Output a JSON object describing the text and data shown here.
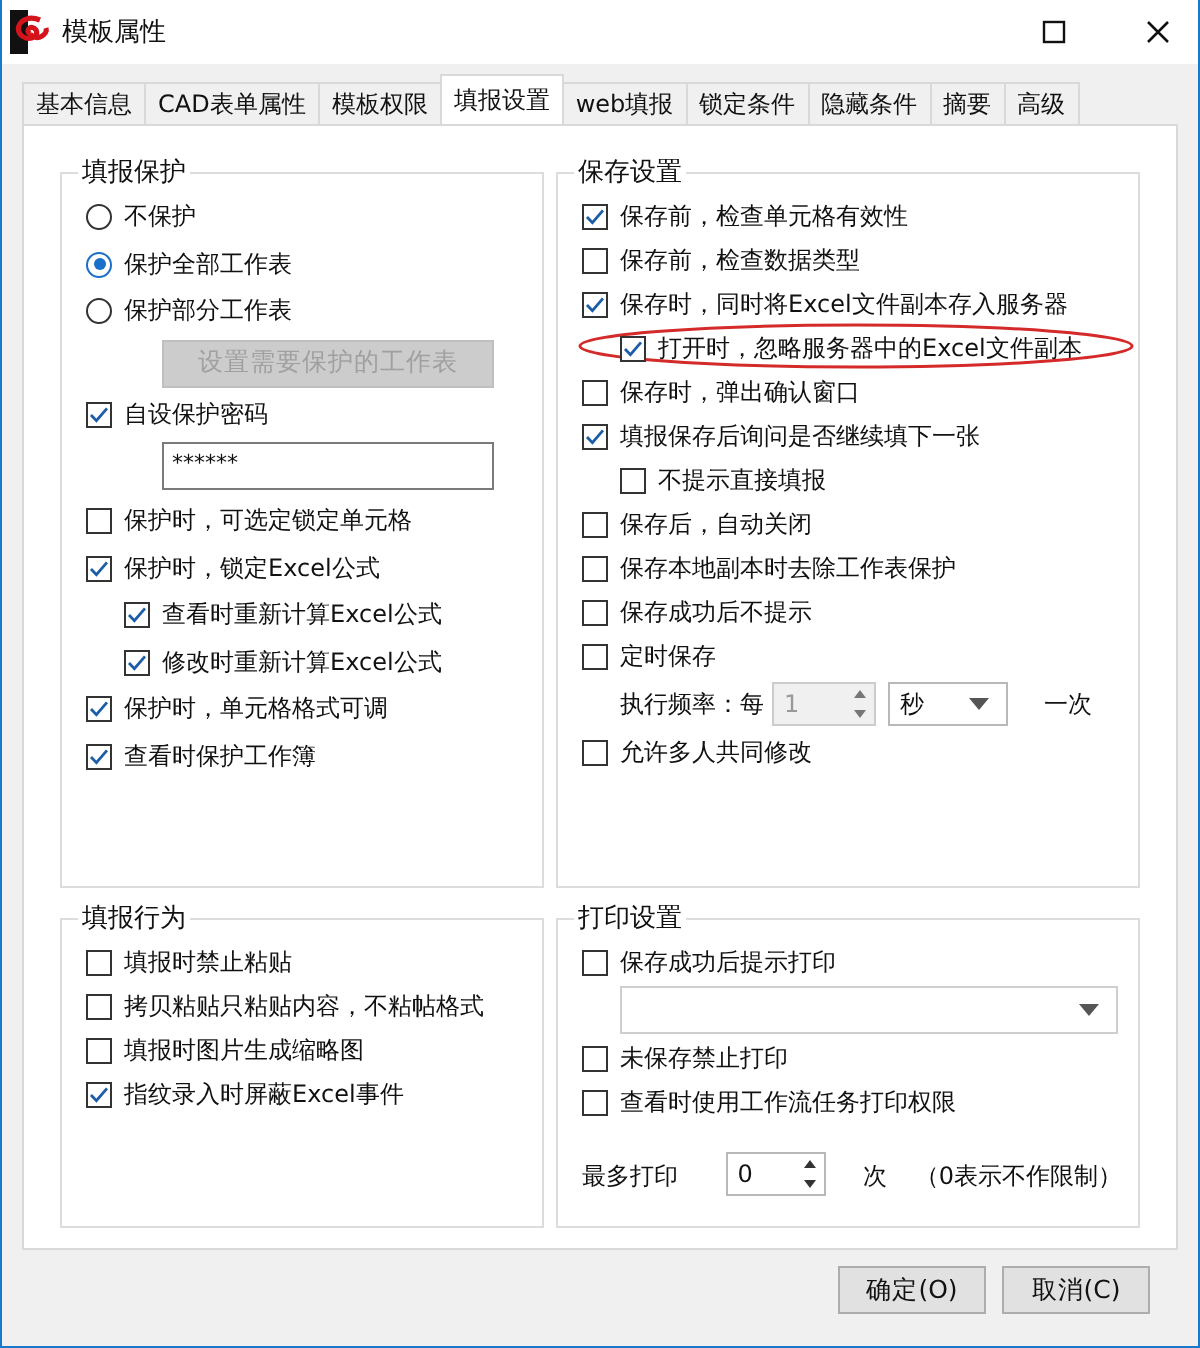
{
  "window": {
    "title": "模板属性"
  },
  "tabs": [
    {
      "label": "基本信息",
      "selected": false
    },
    {
      "label": "CAD表单属性",
      "selected": false
    },
    {
      "label": "模板权限",
      "selected": false
    },
    {
      "label": "填报设置",
      "selected": true
    },
    {
      "label": "web填报",
      "selected": false
    },
    {
      "label": "锁定条件",
      "selected": false
    },
    {
      "label": "隐藏条件",
      "selected": false
    },
    {
      "label": "摘要",
      "selected": false
    },
    {
      "label": "高级",
      "selected": false
    }
  ],
  "protection": {
    "title": "填报保护",
    "items": [
      {
        "kind": "radio",
        "label": "不保护",
        "selected": false
      },
      {
        "kind": "radio",
        "label": "保护全部工作表",
        "selected": true
      },
      {
        "kind": "radio",
        "label": "保护部分工作表",
        "selected": false,
        "children": [
          {
            "kind": "button",
            "label": "设置需要保护的工作表",
            "disabled": true
          }
        ]
      },
      {
        "kind": "checkbox",
        "label": "自设保护密码",
        "checked": true,
        "children": [
          {
            "kind": "password",
            "value": "******"
          }
        ]
      },
      {
        "kind": "checkbox",
        "label": "保护时，可选定锁定单元格",
        "checked": false
      },
      {
        "kind": "checkbox",
        "label": "保护时，锁定Excel公式",
        "checked": true,
        "children": [
          {
            "kind": "checkbox",
            "label": "查看时重新计算Excel公式",
            "checked": true
          },
          {
            "kind": "checkbox",
            "label": "修改时重新计算Excel公式",
            "checked": true
          }
        ]
      },
      {
        "kind": "checkbox",
        "label": "保护时，单元格格式可调",
        "checked": true
      },
      {
        "kind": "checkbox",
        "label": "查看时保护工作簿",
        "checked": true
      }
    ]
  },
  "save": {
    "title": "保存设置",
    "items": [
      {
        "kind": "checkbox",
        "label": "保存前，检查单元格有效性",
        "checked": true
      },
      {
        "kind": "checkbox",
        "label": "保存前，检查数据类型",
        "checked": false
      },
      {
        "kind": "checkbox",
        "label": "保存时，同时将Excel文件副本存入服务器",
        "checked": true,
        "children": [
          {
            "kind": "checkbox",
            "label": "打开时，忽略服务器中的Excel文件副本",
            "checked": true,
            "highlighted": true
          }
        ]
      },
      {
        "kind": "checkbox",
        "label": "保存时，弹出确认窗口",
        "checked": false
      },
      {
        "kind": "checkbox",
        "label": "填报保存后询问是否继续填下一张",
        "checked": true,
        "children": [
          {
            "kind": "checkbox",
            "label": "不提示直接填报",
            "checked": false
          }
        ]
      },
      {
        "kind": "checkbox",
        "label": "保存后，自动关闭",
        "checked": false
      },
      {
        "kind": "checkbox",
        "label": "保存本地副本时去除工作表保护",
        "checked": false
      },
      {
        "kind": "checkbox",
        "label": "保存成功后不提示",
        "checked": false
      },
      {
        "kind": "checkbox",
        "label": "定时保存",
        "checked": false
      },
      {
        "kind": "interval",
        "label": "执行频率：每",
        "value": "1",
        "unit": "秒",
        "suffix": "一次",
        "disabled": true
      },
      {
        "kind": "checkbox",
        "label": "允许多人共同修改",
        "checked": false
      }
    ]
  },
  "behavior": {
    "title": "填报行为",
    "items": [
      {
        "kind": "checkbox",
        "label": "填报时禁止粘贴",
        "checked": false
      },
      {
        "kind": "checkbox",
        "label": "拷贝粘贴只粘贴内容，不粘帖格式",
        "checked": false
      },
      {
        "kind": "checkbox",
        "label": "填报时图片生成缩略图",
        "checked": false
      },
      {
        "kind": "checkbox",
        "label": "指纹录入时屏蔽Excel事件",
        "checked": true
      }
    ]
  },
  "print": {
    "title": "打印设置",
    "items": [
      {
        "kind": "checkbox",
        "label": "保存成功后提示打印",
        "checked": false,
        "children": [
          {
            "kind": "dropdown"
          }
        ]
      },
      {
        "kind": "checkbox",
        "label": "未保存禁止打印",
        "checked": false
      },
      {
        "kind": "checkbox",
        "label": "查看时使用工作流任务打印权限",
        "checked": false
      },
      {
        "kind": "counter",
        "label": "最多打印",
        "value": "0",
        "suffix": "次",
        "note": "（0表示不作限制）"
      }
    ]
  },
  "buttons": [
    "确定(O)",
    "取消(C)"
  ]
}
